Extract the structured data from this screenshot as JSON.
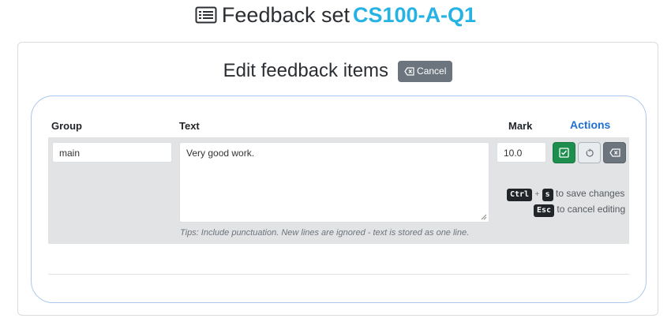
{
  "header": {
    "title_prefix": "Feedback set",
    "title_code": "CS100-A-Q1",
    "icon": "list-box-icon"
  },
  "editor": {
    "heading": "Edit feedback items",
    "cancel_label": "Cancel"
  },
  "table": {
    "columns": {
      "group": "Group",
      "text": "Text",
      "mark": "Mark",
      "actions": "Actions"
    },
    "row": {
      "group": "main",
      "text": "Very good work.",
      "mark": "10.0"
    },
    "tips": "Tips: Include punctuation. New lines are ignored - text is stored as one line."
  },
  "shortcuts": {
    "save_keys": [
      "Ctrl",
      "s"
    ],
    "plus": "+",
    "save_text": "to save changes",
    "cancel_key": "Esc",
    "cancel_text": "to cancel editing"
  },
  "colors": {
    "accent": "#26b3e3",
    "save": "#1e8e4e",
    "secondary": "#6c757d",
    "actions_link": "#1f6fd6"
  }
}
